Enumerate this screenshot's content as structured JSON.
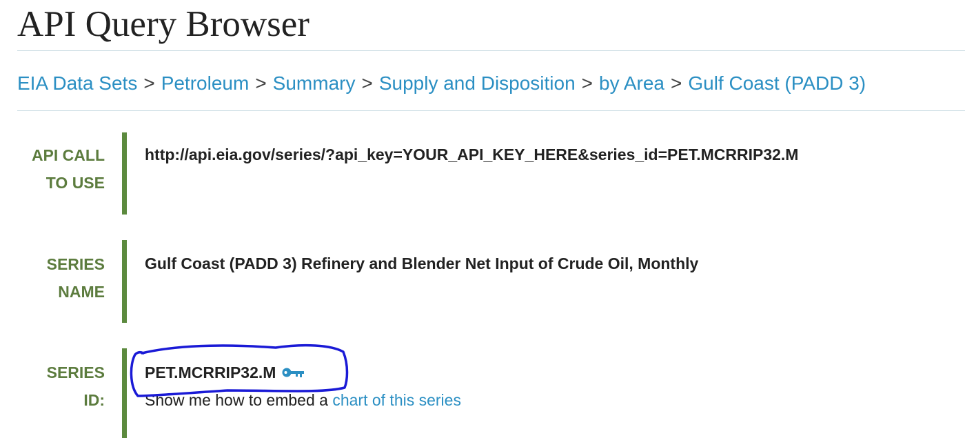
{
  "page": {
    "title": "API Query Browser"
  },
  "breadcrumb": {
    "separator": ">",
    "items": [
      "EIA Data Sets",
      "Petroleum",
      "Summary",
      "Supply and Disposition",
      "by Area",
      "Gulf Coast (PADD 3)"
    ]
  },
  "api_call": {
    "label_line1": "API CALL",
    "label_line2": "TO USE",
    "value": "http://api.eia.gov/series/?api_key=YOUR_API_KEY_HERE&series_id=PET.MCRRIP32.M"
  },
  "series_name": {
    "label_line1": "SERIES",
    "label_line2": "NAME",
    "value": "Gulf Coast (PADD 3) Refinery and Blender Net Input of Crude Oil, Monthly"
  },
  "series_id": {
    "label_line1": "SERIES",
    "label_line2": "ID:",
    "value": "PET.MCRRIP32.M",
    "icon": "key-icon",
    "embed_prefix": "Show me how to embed a ",
    "embed_link": "chart of this series"
  },
  "colors": {
    "link": "#2b8fc3",
    "label": "#5c7c3e",
    "bar": "#5c8a3e",
    "rule": "#c8dbe2",
    "annotation": "#1a1ad6"
  }
}
